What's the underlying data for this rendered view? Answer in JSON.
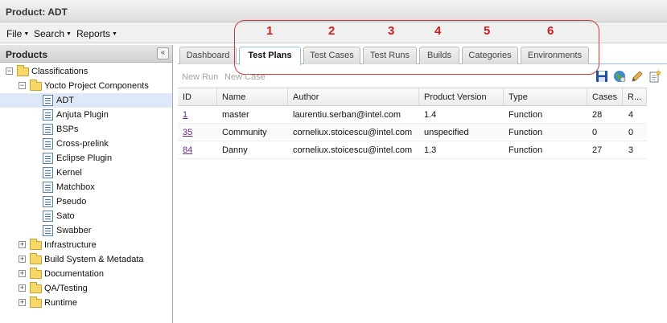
{
  "window": {
    "title": "Product: ADT"
  },
  "menu": {
    "file": "File",
    "search": "Search",
    "reports": "Reports"
  },
  "left_panel": {
    "title": "Products",
    "collapse_glyph": "«",
    "tree": {
      "root": "Classifications",
      "group": "Yocto Project Components",
      "items": [
        "ADT",
        "Anjuta Plugin",
        "BSPs",
        "Cross-prelink",
        "Eclipse Plugin",
        "Kernel",
        "Matchbox",
        "Pseudo",
        "Sato",
        "Swabber"
      ],
      "selected": "ADT",
      "collapsed": [
        "Infrastructure",
        "Build System & Metadata",
        "Documentation",
        "QA/Testing",
        "Runtime"
      ]
    }
  },
  "tabs": [
    "Dashboard",
    "Test Plans",
    "Test Cases",
    "Test Runs",
    "Builds",
    "Categories",
    "Environments"
  ],
  "active_tab": "Test Plans",
  "annotations": [
    "1",
    "2",
    "3",
    "4",
    "5",
    "6"
  ],
  "annotation_color": "#cc1f1f",
  "toolbar": {
    "new_run": "New Run",
    "new_case": "New Case",
    "icons": [
      "save-icon",
      "globe-icon",
      "edit-pencil-icon",
      "new-document-icon"
    ]
  },
  "grid": {
    "columns": [
      "ID",
      "Name",
      "Author",
      "Product Version",
      "Type",
      "Cases",
      "R..."
    ],
    "rows": [
      {
        "id": "1",
        "name": "master",
        "author": "laurentiu.serban@intel.com",
        "version": "1.4",
        "type": "Function",
        "cases": "28",
        "runs": "4"
      },
      {
        "id": "35",
        "name": "Community",
        "author": "corneliux.stoicescu@intel.com",
        "version": "unspecified",
        "type": "Function",
        "cases": "0",
        "runs": "0"
      },
      {
        "id": "84",
        "name": "Danny",
        "author": "corneliux.stoicescu@intel.com",
        "version": "1.3",
        "type": "Function",
        "cases": "27",
        "runs": "3"
      }
    ]
  },
  "colors": {
    "tab_border_active": "#99bbe8",
    "selection": "#dfe8f6",
    "link_visited": "#6a2a8a"
  }
}
